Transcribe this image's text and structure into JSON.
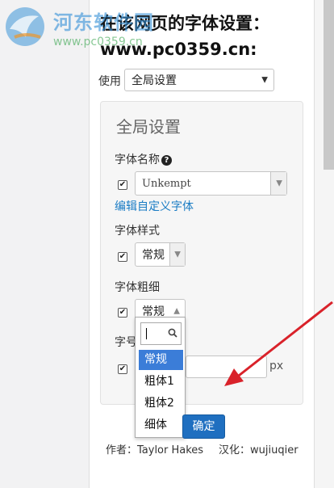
{
  "title": {
    "line1": "在该网页的字体设置：",
    "line2": "www.pc0359.cn:"
  },
  "watermark": {
    "name": "河东软件园",
    "url": "www.pc0359.cn"
  },
  "scope": {
    "label": "使用",
    "value": "全局设置"
  },
  "panel": {
    "title": "全局设置",
    "font_name_label": "字体名称",
    "font_name_value": "Unkempt",
    "edit_custom_link": "编辑自定义字体",
    "font_style_label": "字体样式",
    "font_style_value": "常规",
    "font_weight_label": "字体粗细",
    "font_weight_value": "常规",
    "font_size_label": "字号",
    "font_size_value": "",
    "font_size_unit": "px"
  },
  "weight_dropdown": {
    "search_value": "",
    "options": [
      "常规",
      "粗体1",
      "粗体2",
      "细体"
    ],
    "selected_index": 0
  },
  "confirm_label": "确定",
  "footer": {
    "author": "作者：Taylor Hakes",
    "translator": "汉化：wujiuqier"
  },
  "colors": {
    "accent": "#1f6fc0",
    "selected_option": "#3b7dd8",
    "annotation_arrow": "#d9222a"
  }
}
